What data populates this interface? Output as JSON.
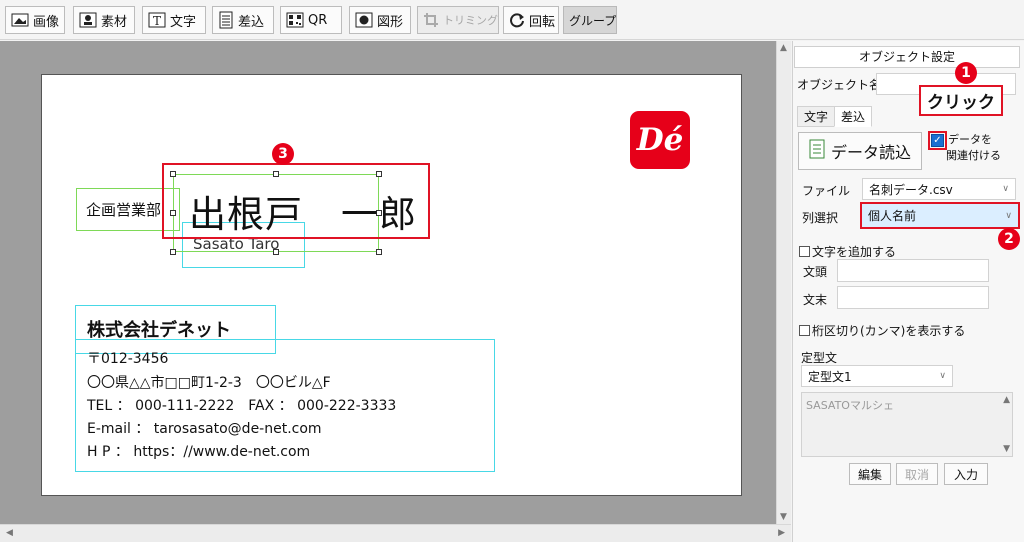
{
  "toolbar": {
    "buttons": [
      {
        "label": "画像",
        "icon": "image-icon"
      },
      {
        "label": "素材",
        "icon": "material-icon"
      },
      {
        "label": "文字",
        "icon": "text-icon"
      },
      {
        "label": "差込",
        "icon": "insert-icon"
      },
      {
        "label": "QR",
        "icon": "qr-icon"
      },
      {
        "label": "図形",
        "icon": "shape-icon"
      },
      {
        "label": "トリミング",
        "icon": "trim-icon"
      },
      {
        "label": "回転",
        "icon": "rotate-icon"
      },
      {
        "label": "グループ",
        "icon": ""
      }
    ]
  },
  "card": {
    "department": "企画営業部",
    "name": "出根戸　一郎",
    "name_roman": "Sasato Taro",
    "company": "株式会社デネット",
    "postal": "〒012-3456",
    "address": "〇〇県△△市□□町1-2-3　〇〇ビル△F",
    "tel_fax": "TEL ： 000-111-2222　FAX ： 000-222-3333",
    "email": "E-mail ： tarosasato@de-net.com",
    "hp": "H P ： https：//www.de-net.com",
    "logo_text": "Dé"
  },
  "annotations": {
    "step1": "1",
    "step2": "2",
    "step3": "3",
    "click_label": "クリック"
  },
  "panel": {
    "title": "オブジェクト設定",
    "object_name_label": "オブジェクト名",
    "object_name_value": "",
    "tabs": [
      "文字",
      "差込"
    ],
    "data_load_button": "データ読込",
    "link_checkbox_label_1": "データを",
    "link_checkbox_label_2": "関連付ける",
    "file_label": "ファイル",
    "file_value": "名刺データ.csv",
    "column_label": "列選択",
    "column_value": "個人名前",
    "add_text_checkbox": "文字を追加する",
    "prefix_label": "文頭",
    "suffix_label": "文末",
    "comma_checkbox": "桁区切り(カンマ)を表示する",
    "template_label": "定型文",
    "template_value": "定型文1",
    "preview_text": "SASATOマルシェ",
    "edit_button": "編集",
    "cancel_button": "取消",
    "input_button": "入力"
  },
  "colors": {
    "accent_red": "#e60019",
    "selection_green": "#7ed957",
    "selection_cyan": "#48d8e6",
    "highlight_blue": "#dbeeff"
  }
}
